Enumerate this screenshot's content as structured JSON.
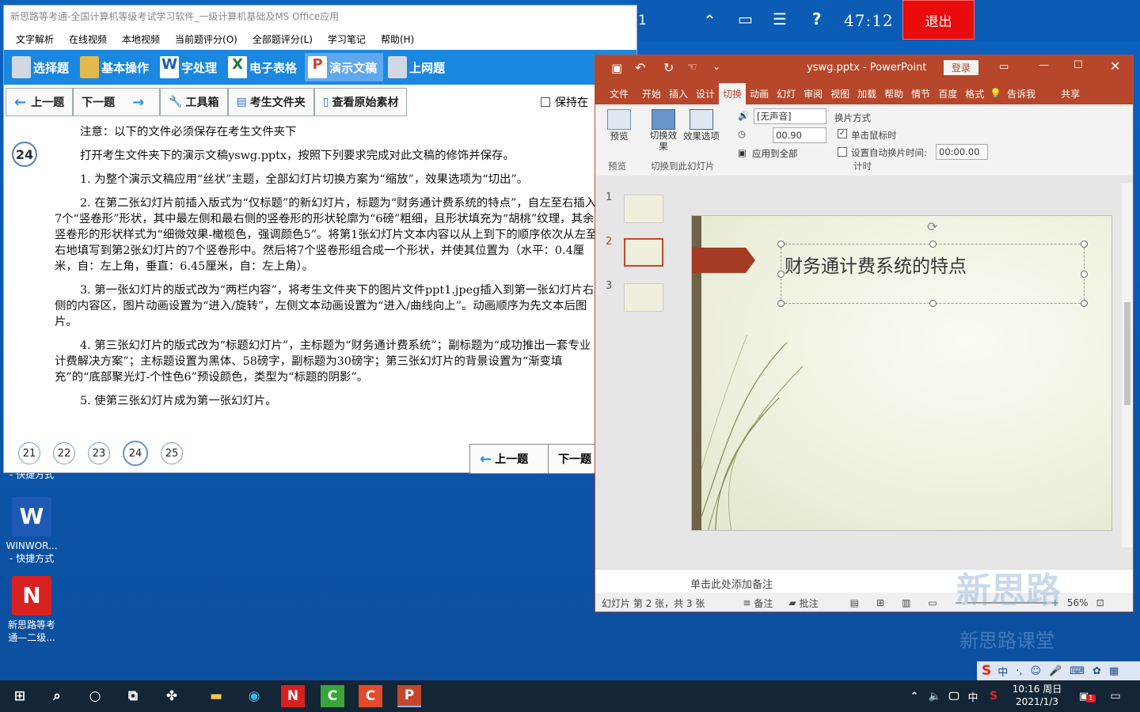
{
  "exam_window": {
    "title": "新思路等考通-全国计算机等级考试学习软件_一级计算机基础及MS Office应用",
    "menu": [
      "文字解析",
      "在线视频",
      "本地视频",
      "当前题评分(O)",
      "全部题评分(L)",
      "学习笔记",
      "帮助(H)"
    ],
    "tabs": [
      "选择题",
      "基本操作",
      "字处理",
      "电子表格",
      "演示文稿",
      "上网题"
    ],
    "active_tab": "演示文稿",
    "nav": {
      "prev": "上一题",
      "next": "下一题",
      "toolbox": "工具箱",
      "student_folder": "考生文件夹",
      "view_material": "查看原始素材",
      "keep": "保持在"
    },
    "question_number": "24",
    "question_text": [
      "注意：以下的文件必须保存在考生文件夹下",
      "打开考生文件夹下的演示文稿yswg.pptx，按照下列要求完成对此文稿的修饰并保存。",
      "1. 为整个演示文稿应用“丝状”主题，全部幻灯片切换方案为“缩放”，效果选项为“切出”。",
      "2. 在第二张幻灯片前插入版式为“仅标题”的新幻灯片，标题为“财务通计费系统的特点”，自左至右插入7个“竖卷形”形状，其中最左侧和最右侧的竖卷形的形状轮廓为“6磅”粗细，且形状填充为“胡桃”纹理，其余竖卷形的形状样式为“细微效果-橄榄色，强调颜色5”。将第1张幻灯片文本内容以从上到下的顺序依次从左至右地填写到第2张幻灯片的7个竖卷形中。然后将7个竖卷形组合成一个形状，并使其位置为（水平：0.4厘米，自：左上角，垂直：6.45厘米，自：左上角）。",
      "3. 第一张幻灯片的版式改为“两栏内容”，将考生文件夹下的图片文件ppt1.jpeg插入到第一张幻灯片右侧的内容区，图片动画设置为“进入/旋转”，左侧文本动画设置为“进入/曲线向上”。动画顺序为先文本后图片。",
      "4. 第三张幻灯片的版式改为“标题幻灯片”，主标题为“财务通计费系统”；副标题为“成功推出一套专业计费解决方案”；主标题设置为黑体、58磅字，副标题为30磅字；第三张幻灯片的背景设置为“渐变填充”的“底部聚光灯-个性色6”预设颜色，类型为“标题的阴影”。",
      "5. 使第三张幻灯片成为第一张幻灯片。"
    ],
    "pager": [
      "21",
      "22",
      "23",
      "24",
      "25"
    ],
    "current_page": "24"
  },
  "exam_topbar": {
    "partial_number": "1",
    "timer": "47:12",
    "exit": "退出"
  },
  "desktop_icons": [
    {
      "label": "- 快捷方式"
    },
    {
      "label": "WINWOR...\n- 快捷方式"
    },
    {
      "label": "新思路等考\n通—二级..."
    }
  ],
  "ppt": {
    "filename": "yswg.pptx",
    "app": "PowerPoint",
    "login": "登录",
    "ribbon_tabs": [
      "文件",
      "开始",
      "插入",
      "设计",
      "切换",
      "动画",
      "幻灯",
      "审阅",
      "视图",
      "加载",
      "帮助",
      "情节",
      "百度",
      "格式",
      "告诉我",
      "共享"
    ],
    "active_ribbon_tab": "切换",
    "ribbon": {
      "preview": "预览",
      "switch_effect": "切换效果",
      "effect_options": "效果选项",
      "sound": "[无声音]",
      "duration": "00.90",
      "apply_all": "应用到全部",
      "advance_title": "换片方式",
      "on_click": "单击鼠标时",
      "on_click_checked": true,
      "auto_after": "设置自动换片时间:",
      "auto_time": "00:00.00",
      "group_preview": "预览",
      "group_switch": "切换到此幻灯片",
      "group_timing": "计时"
    },
    "slides": [
      "1",
      "2",
      "3"
    ],
    "selected_slide": "2",
    "slide_title": "财务通计费系统的特点",
    "notes_placeholder": "单击此处添加备注",
    "status": {
      "slide_info": "幻灯片 第 2 张，共 3 张",
      "notes": "备注",
      "comments": "批注",
      "zoom": "56%"
    }
  },
  "taskbar": {
    "time": "10:16 周日",
    "date": "2021/1/3",
    "ime": "中",
    "notify_badge": "1"
  },
  "watermark": {
    "line1": "新思路",
    "line2": "新思路课堂"
  }
}
